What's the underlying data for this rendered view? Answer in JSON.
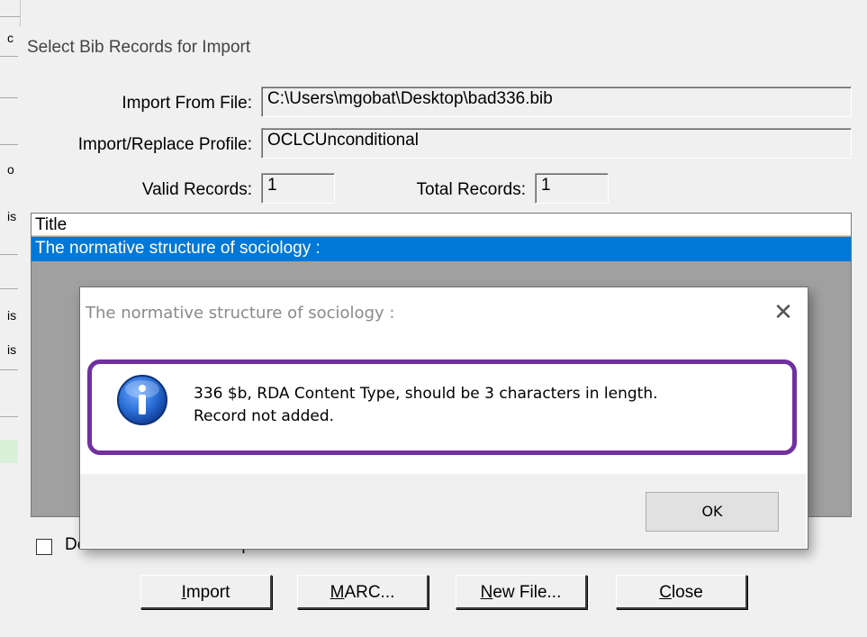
{
  "background_app": {
    "fragments": [
      "c",
      "o",
      "is",
      "is",
      "is"
    ]
  },
  "dialog": {
    "title": "Select Bib Records for Import",
    "import_from_file_label": "Import From File:",
    "import_from_file_value": "C:\\Users\\mgobat\\Desktop\\bad336.bib",
    "profile_label": "Import/Replace Profile:",
    "profile_value": "OCLCUnconditional",
    "valid_records_label": "Valid Records:",
    "valid_records_value": "1",
    "total_records_label": "Total Records:",
    "total_records_value": "1",
    "list": {
      "column_header": "Title",
      "rows": [
        "The normative structure of sociology :"
      ]
    },
    "delete_checkbox_label": "Delete from file after import",
    "delete_checkbox_checked": false,
    "buttons": {
      "import": {
        "label": "Import",
        "mnemonic": "I",
        "rest": "mport"
      },
      "marc": {
        "label": "MARC...",
        "mnemonic": "M",
        "rest": "ARC..."
      },
      "new_file": {
        "label": "New File...",
        "mnemonic": "N",
        "rest": "ew File..."
      },
      "close": {
        "label": "Close",
        "mnemonic": "C",
        "rest": "lose"
      }
    }
  },
  "message_box": {
    "title": "The normative structure of sociology :",
    "close_glyph": "✕",
    "icon": "info-icon",
    "line1": "336 $b, RDA Content Type, should be 3 characters in length.",
    "line2": "Record not added.",
    "ok_label": "OK"
  },
  "colors": {
    "selection": "#0078d7",
    "highlight_border": "#7030a0",
    "info_icon": "#1f5fb8"
  }
}
